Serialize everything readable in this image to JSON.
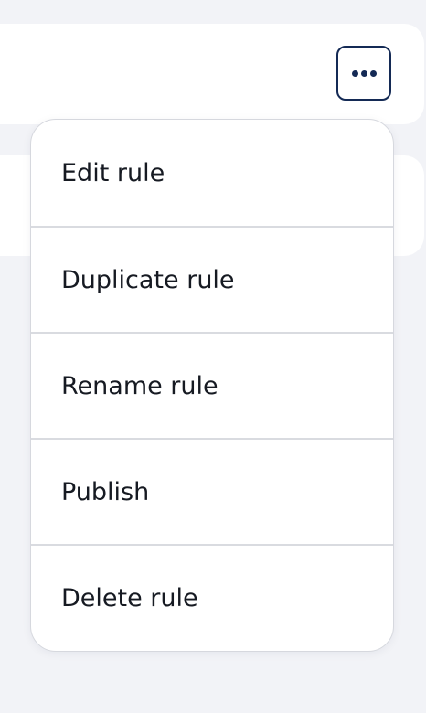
{
  "header": {
    "more_icon": "more-horizontal-icon"
  },
  "menu": {
    "items": [
      {
        "label": "Edit rule"
      },
      {
        "label": "Duplicate rule"
      },
      {
        "label": "Rename rule"
      },
      {
        "label": "Publish"
      },
      {
        "label": "Delete rule"
      }
    ]
  },
  "colors": {
    "background": "#f2f3f7",
    "card": "#ffffff",
    "accent_navy": "#142a55",
    "text": "#161a22",
    "divider": "#d9dbe0"
  }
}
